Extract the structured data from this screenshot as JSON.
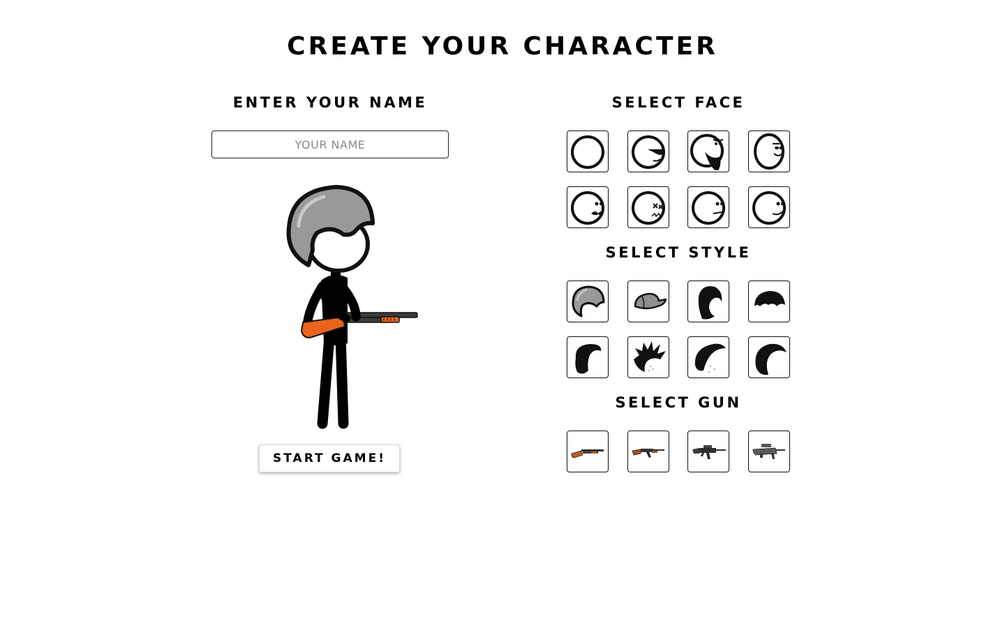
{
  "title": "CREATE YOUR CHARACTER",
  "name_section": {
    "heading": "ENTER YOUR NAME",
    "placeholder": "YOUR NAME",
    "value": ""
  },
  "face_section": {
    "heading": "SELECT FACE",
    "options": [
      {
        "icon": "blank-face-icon"
      },
      {
        "icon": "sunglasses-face-icon"
      },
      {
        "icon": "bearded-face-icon"
      },
      {
        "icon": "smiling-face-icon"
      },
      {
        "icon": "mustache-face-icon"
      },
      {
        "icon": "dead-x-eyes-face-icon"
      },
      {
        "icon": "neutral-face-icon"
      },
      {
        "icon": "smirk-face-icon"
      }
    ]
  },
  "style_section": {
    "heading": "SELECT STYLE",
    "selected": "helmet-icon",
    "options": [
      {
        "icon": "helmet-icon"
      },
      {
        "icon": "cap-icon"
      },
      {
        "icon": "long-hair-icon"
      },
      {
        "icon": "bowl-hair-icon"
      },
      {
        "icon": "swoop-hair-icon"
      },
      {
        "icon": "spiky-hair-icon"
      },
      {
        "icon": "mohawk-hair-icon"
      },
      {
        "icon": "flip-hair-icon"
      }
    ]
  },
  "gun_section": {
    "heading": "SELECT GUN",
    "selected": "shotgun-icon",
    "options": [
      {
        "icon": "shotgun-icon"
      },
      {
        "icon": "ak-rifle-icon"
      },
      {
        "icon": "assault-rifle-icon"
      },
      {
        "icon": "bullpup-rifle-icon"
      }
    ]
  },
  "start_button": "START GAME!",
  "colors": {
    "text": "#000000",
    "helmet": "#999999",
    "gun_wood": "#e8641c",
    "gun_metal": "#3a3a3a"
  }
}
